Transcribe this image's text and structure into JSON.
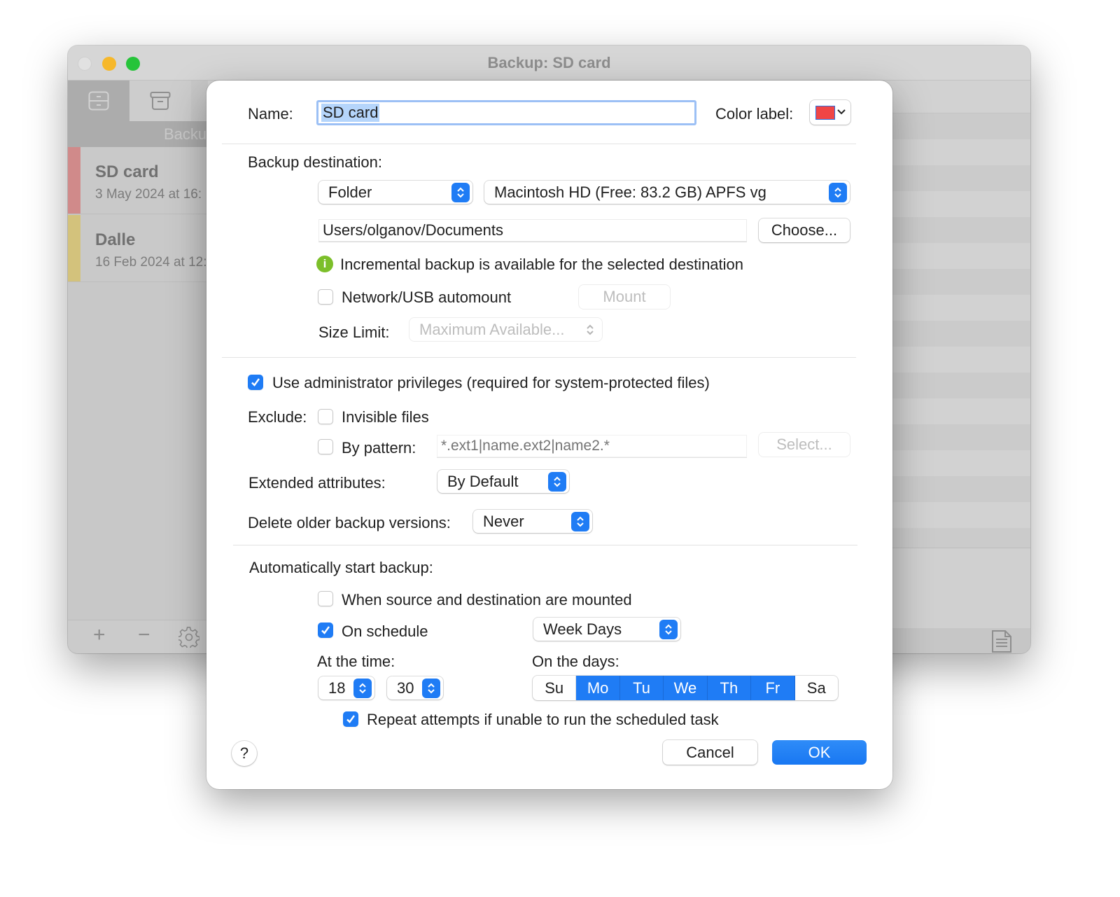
{
  "window": {
    "title": "Backup: SD card",
    "sidebar": {
      "header_label": "Backu",
      "items": [
        {
          "name": "SD card",
          "date": "3 May 2024 at 16:",
          "color": "#d08a8a"
        },
        {
          "name": "Dalle",
          "date": "16 Feb 2024 at 12:",
          "color": "#d3c27c"
        }
      ],
      "footer": {
        "add": "+",
        "remove": "−"
      }
    }
  },
  "dialog": {
    "name_label": "Name:",
    "name_value": "SD card",
    "color_label": "Color label:",
    "color_value": "#f04545",
    "destination": {
      "label": "Backup destination:",
      "type_value": "Folder",
      "volume_value": "Macintosh HD (Free: 83.2 GB) APFS vg",
      "path_value": "Users/olganov/Documents",
      "choose_button": "Choose...",
      "info_text": "Incremental backup is available for the selected destination",
      "automount_label": "Network/USB automount",
      "automount_checked": false,
      "mount_button": "Mount",
      "size_limit_label": "Size Limit:",
      "size_limit_value": "Maximum Available..."
    },
    "options": {
      "admin_label": "Use administrator privileges (required for system-protected files)",
      "admin_checked": true,
      "exclude_label": "Exclude:",
      "invisible_label": "Invisible files",
      "invisible_checked": false,
      "pattern_label": "By pattern:",
      "pattern_checked": false,
      "pattern_placeholder": "*.ext1|name.ext2|name2.*",
      "select_button": "Select...",
      "ext_attr_label": "Extended attributes:",
      "ext_attr_value": "By Default",
      "delete_label": "Delete older backup versions:",
      "delete_value": "Never"
    },
    "schedule": {
      "label": "Automatically start backup:",
      "mounted_label": "When source and destination are mounted",
      "mounted_checked": false,
      "on_schedule_label": "On schedule",
      "on_schedule_checked": true,
      "frequency_value": "Week Days",
      "time_label": "At the time:",
      "hour": "18",
      "minute": "30",
      "days_label": "On the days:",
      "days": [
        {
          "label": "Su",
          "selected": false
        },
        {
          "label": "Mo",
          "selected": true
        },
        {
          "label": "Tu",
          "selected": true
        },
        {
          "label": "We",
          "selected": true
        },
        {
          "label": "Th",
          "selected": true
        },
        {
          "label": "Fr",
          "selected": true
        },
        {
          "label": "Sa",
          "selected": false
        }
      ],
      "repeat_label": "Repeat attempts if unable to run the scheduled task",
      "repeat_checked": true
    },
    "buttons": {
      "help": "?",
      "cancel": "Cancel",
      "ok": "OK"
    }
  },
  "colors": {
    "accent": "#1f7cf5",
    "info_green": "#7cbf2a"
  }
}
